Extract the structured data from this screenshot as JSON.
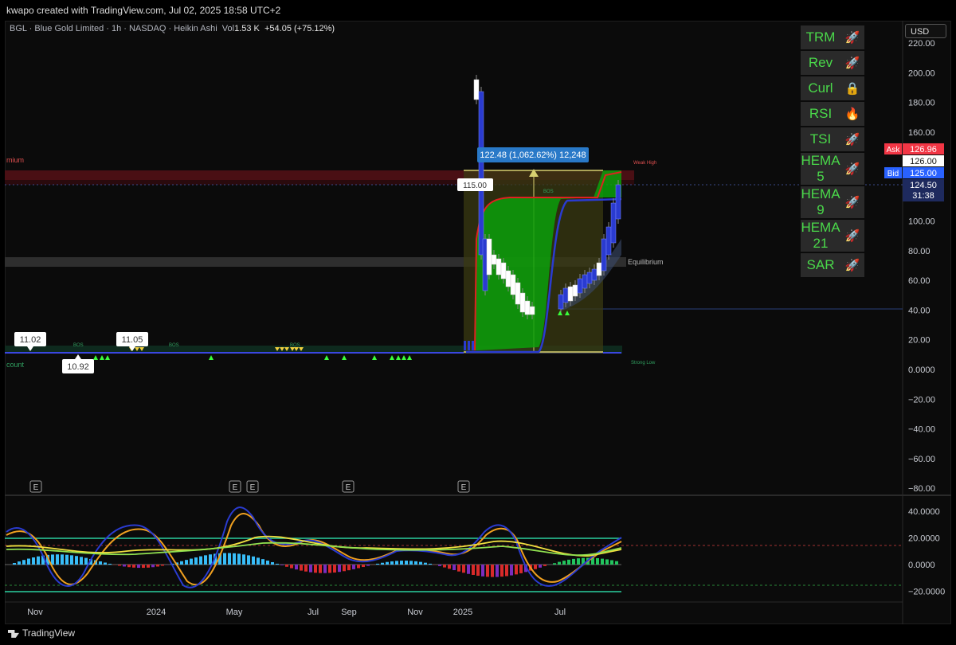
{
  "header": {
    "credit": "kwapo created with TradingView.com, Jul 02, 2025 18:58 UTC+2"
  },
  "legend": {
    "symbol": "BGL · Blue Gold Limited · 1h · NASDAQ · Heikin Ashi",
    "vol_label": "Vol",
    "vol_value": "1.53 K",
    "change": "+54.05 (+75.12%)"
  },
  "currency": "USD",
  "signal_table": [
    {
      "label": "TRM",
      "icon": "🚀"
    },
    {
      "label": "Rev",
      "icon": "🚀"
    },
    {
      "label": "Curl",
      "icon": "🔒"
    },
    {
      "label": "RSI",
      "icon": "🔥"
    },
    {
      "label": "TSI",
      "icon": "🚀"
    },
    {
      "label": "HEMA 5",
      "icon": "🚀"
    },
    {
      "label": "HEMA 9",
      "icon": "🚀"
    },
    {
      "label": "HEMA 21",
      "icon": "🚀"
    },
    {
      "label": "SAR",
      "icon": "🚀"
    }
  ],
  "price_axis": {
    "ticks": [
      "220.00",
      "200.00",
      "180.00",
      "160.00",
      "140.00",
      "120.00",
      "100.00",
      "80.00",
      "60.00",
      "40.00",
      "20.00",
      "0.0000",
      "−20.00",
      "−40.00",
      "−60.00",
      "−80.00"
    ],
    "values": [
      220,
      200,
      180,
      160,
      140,
      120,
      100,
      80,
      60,
      40,
      20,
      0,
      -20,
      -40,
      -60,
      -80
    ],
    "ask_label": "Ask",
    "ask_value": "126.96",
    "last_value": "126.00",
    "bid_label": "Bid",
    "bid_value": "125.00",
    "current_value": "124.50",
    "countdown": "31:38"
  },
  "osc_axis": {
    "ticks": [
      "40.0000",
      "20.0000",
      "0.0000",
      "−20.0000"
    ],
    "values": [
      40,
      20,
      0,
      -20
    ]
  },
  "time_axis": {
    "labels": [
      "Nov",
      "2024",
      "May",
      "Jul",
      "Sep",
      "Nov",
      "2025",
      "Jul"
    ]
  },
  "annotations": {
    "measure": "122.48 (1,062.62%) 12,248",
    "label_115": "115.00",
    "label_1102": "11.02",
    "label_1092": "10.92",
    "label_1105": "11.05",
    "premium": "mium",
    "discount": "count",
    "equilibrium": "Equilibrium",
    "weak_high": "Weak High",
    "strong_low": "Strong Low",
    "bos": "BOS",
    "earnings": "E"
  },
  "brand": {
    "name": "TradingView"
  },
  "colors": {
    "bull": "#ffffff",
    "bear": "#2a3bd0",
    "zone_green": "#0a9a0a",
    "axis_tag_red": "#f23645",
    "axis_tag_blue": "#2962ff",
    "table_text": "#4ad94a"
  }
}
